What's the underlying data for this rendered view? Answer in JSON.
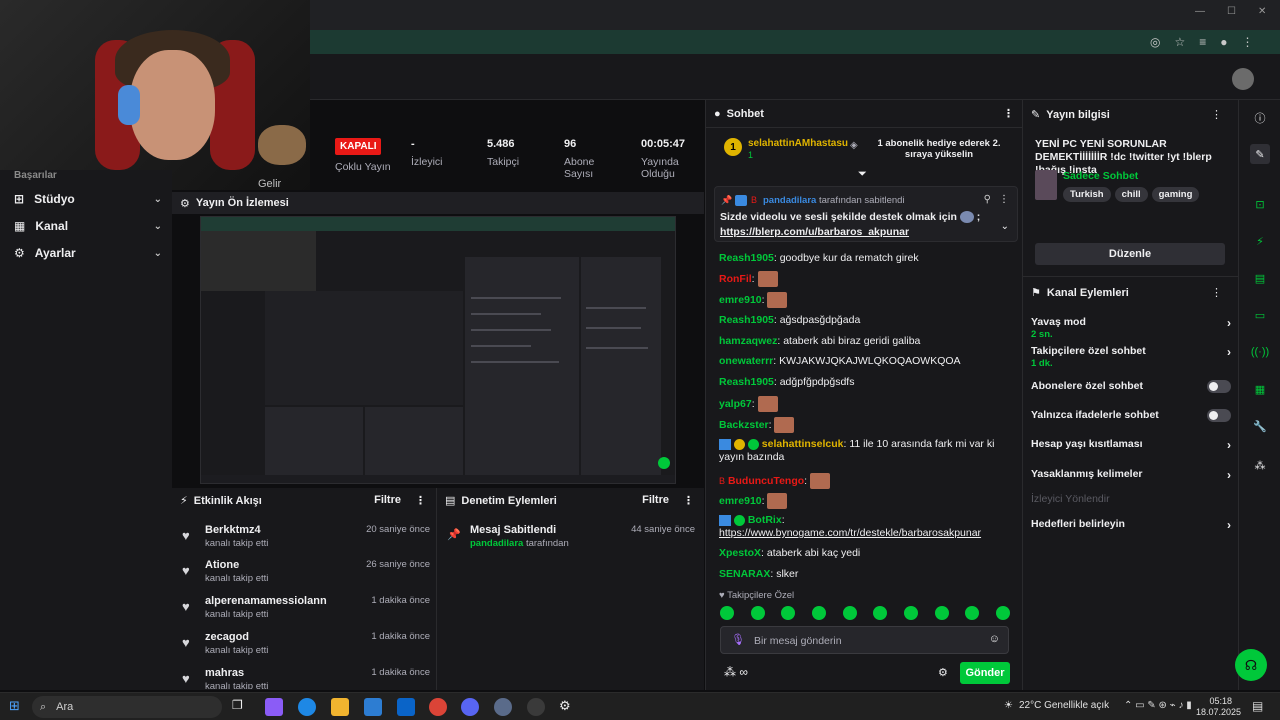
{
  "webcam": {
    "gelir_label": "Gelir"
  },
  "sidebar": {
    "partial_label": "Başarılar",
    "items": [
      {
        "label": "Stüdyo",
        "icon": "studio-icon"
      },
      {
        "label": "Kanal",
        "icon": "channel-icon"
      },
      {
        "label": "Ayarlar",
        "icon": "gear-icon"
      }
    ]
  },
  "stats": {
    "status": "KAPALI",
    "status_label": "Çoklu Yayın",
    "viewers_value": "-",
    "viewers_label": "İzleyici",
    "followers_value": "5.486",
    "followers_label": "Takipçi",
    "subs_value": "96",
    "subs_label": "Abone Sayısı",
    "uptime_value": "00:05:47",
    "uptime_label": "Yayında Olduğu"
  },
  "preview": {
    "title": "Yayın Ön İzlemesi"
  },
  "activity": {
    "title": "Etkinlik Akışı",
    "filter": "Filtre",
    "items": [
      {
        "name": "Berkktmz4",
        "sub": "kanalı takip etti",
        "time": "20 saniye önce"
      },
      {
        "name": "Atione",
        "sub": "kanalı takip etti",
        "time": "26 saniye önce"
      },
      {
        "name": "alperenamamessiolann",
        "sub": "kanalı takip etti",
        "time": "1 dakika önce"
      },
      {
        "name": "zecagod",
        "sub": "kanalı takip etti",
        "time": "1 dakika önce"
      },
      {
        "name": "mahras",
        "sub": "kanalı takip etti",
        "time": "1 dakika önce"
      }
    ]
  },
  "moderation": {
    "title": "Denetim Eylemleri",
    "filter": "Filtre",
    "item_title": "Mesaj Sabitlendi",
    "item_user": "pandadilara",
    "item_suffix": "tarafından",
    "item_time": "44 saniye önce"
  },
  "chat": {
    "title": "Sohbet",
    "gift_user": "selahattinAMhastasu",
    "gift_count": "1",
    "gift_text": "1 abonelik hediye ederek 2. sıraya yükselin",
    "pin_user": "pandadilara",
    "pin_suffix": "tarafından sabitlendi",
    "pin_text": "Sizde videolu ve sesli şekilde destek olmak için",
    "pin_semicolon": ";",
    "pin_link": "https://blerp.com/u/barbaros_akpunar",
    "messages": [
      {
        "user": "Reash1905",
        "color": "#00c83a",
        "text": "goodbye kur da rematch girek",
        "emote": false
      },
      {
        "user": "RonFil",
        "color": "#e91916",
        "text": "",
        "emote": true
      },
      {
        "user": "emre910",
        "color": "#00c83a",
        "text": "",
        "emote": true
      },
      {
        "user": "Reash1905",
        "color": "#00c83a",
        "text": "ağsdpasğdpğada",
        "emote": false
      },
      {
        "user": "hamzaqwez",
        "color": "#00c83a",
        "text": "ataberk abi biraz geridi galiba",
        "emote": false
      },
      {
        "user": "onewaterrr",
        "color": "#00c83a",
        "text": "KWJAKWJQKAJWLQKOQAOWKQOA",
        "emote": false
      },
      {
        "user": "Reash1905",
        "color": "#00c83a",
        "text": "adğpfğpdpğsdfs",
        "emote": false
      },
      {
        "user": "yalp67",
        "color": "#00c83a",
        "text": "",
        "emote": true
      },
      {
        "user": "Backzster",
        "color": "#00c83a",
        "text": "",
        "emote": true
      },
      {
        "user": "selahattinselcuk",
        "color": "#e0b400",
        "text": "11 ile 10 arasında fark mi var ki yayın bazında",
        "emote": false
      },
      {
        "user": "BuduncuTengo",
        "color": "#e91916",
        "text": "",
        "emote": true
      },
      {
        "user": "emre910",
        "color": "#00c83a",
        "text": "",
        "emote": true
      },
      {
        "user": "BotRix",
        "color": "#00c83a",
        "text": "https://www.bynogame.com/tr/destekle/barbarosakpunar",
        "emote": false
      },
      {
        "user": "XpestoX",
        "color": "#00c83a",
        "text": "ataberk abi kaç yedi",
        "emote": false
      },
      {
        "user": "SENARAX",
        "color": "#00c83a",
        "text": "slker",
        "emote": false
      }
    ],
    "followers_only": "Takipçilere Özel",
    "input_placeholder": "Bir mesaj gönderin",
    "send": "Gönder"
  },
  "stream_info": {
    "title": "Yayın bilgisi",
    "stream_title": "YENİ PC YENİ SORUNLAR DEMEKTİİİİİİİR !dc !twitter !yt !blerp !bağış !insta",
    "category": "Sadece Sohbet",
    "tags": [
      "Turkish",
      "chill",
      "gaming"
    ],
    "edit": "Düzenle"
  },
  "channel_actions": {
    "title": "Kanal Eylemleri",
    "slow_mode": "Yavaş mod",
    "slow_mode_value": "2 sn.",
    "followers_chat": "Takipçilere özel sohbet",
    "followers_chat_value": "1 dk.",
    "subs_chat": "Abonelere özel sohbet",
    "emote_chat": "Yalnızca ifadelerle sohbet",
    "account_age": "Hesap yaşı kısıtlaması",
    "banned_words": "Yasaklanmış kelimeler",
    "redirect": "İzleyici Yönlendir",
    "goals": "Hedefleri belirleyin"
  },
  "taskbar": {
    "search": "Ara",
    "weather": "22°C Genellikle açık",
    "time": "05:18",
    "date": "18.07.2025"
  },
  "colors": {
    "accent": "#00c83a",
    "danger": "#e91916",
    "bg": "#0e0e10",
    "panel": "#18181b"
  }
}
